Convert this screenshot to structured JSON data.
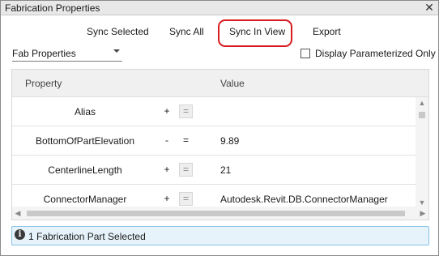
{
  "window": {
    "title": "Fabrication Properties",
    "close_glyph": "✕"
  },
  "toolbar": {
    "sync_selected": "Sync Selected",
    "sync_all": "Sync All",
    "sync_in_view": "Sync In View",
    "export": "Export",
    "highlight_color": "#d81b20"
  },
  "filter": {
    "dropdown_value": "Fab Properties",
    "checkbox_label": "Display Parameterized Only",
    "checkbox_checked": false
  },
  "grid": {
    "columns": [
      "Property",
      "Value"
    ],
    "rows": [
      {
        "name": "Alias",
        "op": "+",
        "eq": "=",
        "eq_boxed": true,
        "value": ""
      },
      {
        "name": "BottomOfPartElevation",
        "op": "-",
        "eq": "=",
        "eq_boxed": false,
        "value": "9.89"
      },
      {
        "name": "CenterlineLength",
        "op": "+",
        "eq": "=",
        "eq_boxed": true,
        "value": "21"
      },
      {
        "name": "ConnectorManager",
        "op": "+",
        "eq": "=",
        "eq_boxed": true,
        "value": "Autodesk.Revit.DB.ConnectorManager"
      }
    ]
  },
  "status": {
    "icon": "info-icon",
    "icon_glyph": "i",
    "text": "1 Fabrication Part Selected",
    "background": "#e6f3fb",
    "border": "#86c3e6"
  }
}
